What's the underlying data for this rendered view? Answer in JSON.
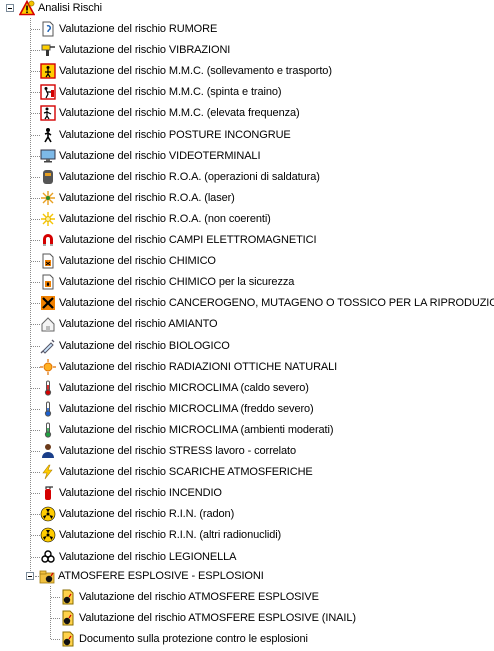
{
  "root": {
    "label": "Analisi Rischi",
    "icon": "warning-triangle-icon"
  },
  "items": [
    {
      "label": "Valutazione del rischio RUMORE",
      "icon": "ear-document-icon"
    },
    {
      "label": "Valutazione del rischio VIBRAZIONI",
      "icon": "drill-icon"
    },
    {
      "label": "Valutazione del rischio M.M.C. (sollevamento e trasporto)",
      "icon": "lifting-sign-icon"
    },
    {
      "label": "Valutazione del rischio M.M.C. (spinta e traino)",
      "icon": "pushing-sign-icon"
    },
    {
      "label": "Valutazione del rischio M.M.C. (elevata frequenza)",
      "icon": "repetitive-sign-icon"
    },
    {
      "label": "Valutazione del rischio POSTURE INCONGRUE",
      "icon": "walking-person-icon"
    },
    {
      "label": "Valutazione del rischio VIDEOTERMINALI",
      "icon": "monitor-icon"
    },
    {
      "label": "Valutazione del rischio R.O.A. (operazioni di saldatura)",
      "icon": "welding-mask-icon"
    },
    {
      "label": "Valutazione del rischio R.O.A. (laser)",
      "icon": "laser-icon"
    },
    {
      "label": "Valutazione del rischio R.O.A. (non coerenti)",
      "icon": "light-burst-icon"
    },
    {
      "label": "Valutazione del rischio CAMPI ELETTROMAGNETICI",
      "icon": "magnet-icon"
    },
    {
      "label": "Valutazione del rischio CHIMICO",
      "icon": "chemical-document-icon"
    },
    {
      "label": "Valutazione del rischio CHIMICO per la sicurezza",
      "icon": "flammable-document-icon"
    },
    {
      "label": "Valutazione del rischio CANCEROGENO, MUTAGENO O TOSSICO PER LA RIPRODUZIONE",
      "icon": "harmful-x-icon"
    },
    {
      "label": "Valutazione del rischio AMIANTO",
      "icon": "house-icon"
    },
    {
      "label": "Valutazione del rischio BIOLOGICO",
      "icon": "syringe-icon"
    },
    {
      "label": "Valutazione del rischio RADIAZIONI OTTICHE NATURALI",
      "icon": "sun-icon"
    },
    {
      "label": "Valutazione del rischio MICROCLIMA (caldo severo)",
      "icon": "thermometer-hot-icon"
    },
    {
      "label": "Valutazione del rischio MICROCLIMA (freddo severo)",
      "icon": "thermometer-cold-icon"
    },
    {
      "label": "Valutazione del rischio MICROCLIMA (ambienti moderati)",
      "icon": "thermometer-moderate-icon"
    },
    {
      "label": "Valutazione del rischio STRESS lavoro - correlato",
      "icon": "stressed-person-icon"
    },
    {
      "label": "Valutazione del rischio SCARICHE ATMOSFERICHE",
      "icon": "lightning-icon"
    },
    {
      "label": "Valutazione del rischio INCENDIO",
      "icon": "fire-extinguisher-icon"
    },
    {
      "label": "Valutazione del rischio R.I.N. (radon)",
      "icon": "radiation-rn-icon"
    },
    {
      "label": "Valutazione del rischio R.I.N. (altri radionuclidi)",
      "icon": "radiation-icon"
    },
    {
      "label": "Valutazione del rischio LEGIONELLA",
      "icon": "biohazard-icon"
    }
  ],
  "group": {
    "label": "ATMOSFERE ESPLOSIVE - ESPLOSIONI",
    "icon": "explosive-folder-icon",
    "children": [
      {
        "label": "Valutazione del rischio ATMOSFERE ESPLOSIVE",
        "icon": "bomb-document-icon"
      },
      {
        "label": "Valutazione del rischio ATMOSFERE ESPLOSIVE (INAIL)",
        "icon": "bomb-document-icon"
      },
      {
        "label": "Documento sulla protezione contro le esplosioni",
        "icon": "bomb-document-icon"
      }
    ]
  },
  "colors": {
    "background": "#ffffff",
    "text": "#000000",
    "tree_lines": "#8a8a8a",
    "warning_red": "#d40000",
    "warning_yellow": "#ffcc00"
  }
}
